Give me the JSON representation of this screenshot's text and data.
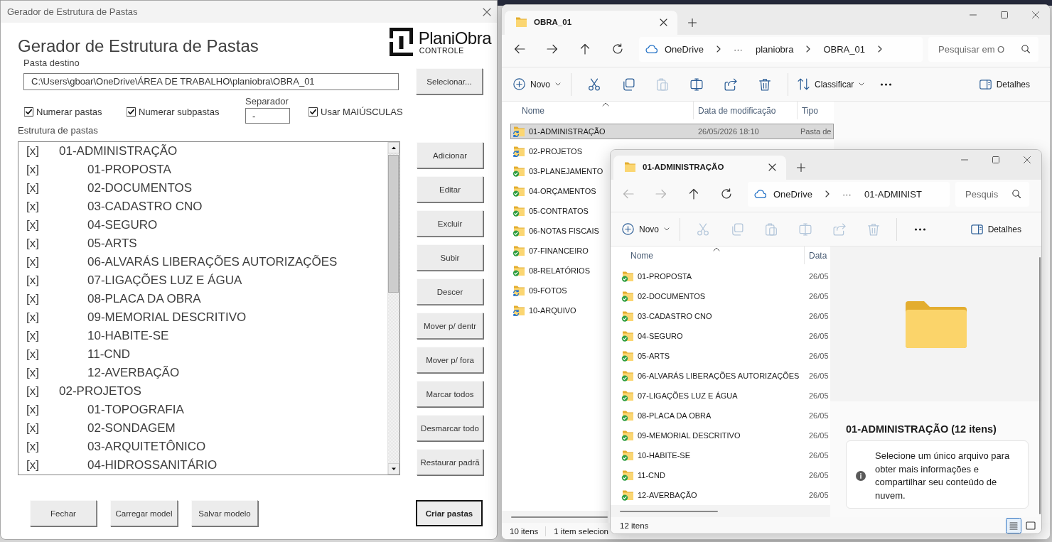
{
  "dialog": {
    "title": "Gerador de Estrutura de Pastas",
    "heading": "Gerador de Estrutura de Pastas",
    "logo": {
      "name": "PlaniObra",
      "tagline": "CONTROLE"
    },
    "destination": {
      "label": "Pasta destino",
      "value": "C:\\Users\\gboar\\OneDrive\\ÁREA DE TRABALHO\\planiobra\\OBRA_01",
      "button": "Selecionar..."
    },
    "options": [
      {
        "kind": "checkbox",
        "label": "Numerar pastas",
        "checked": true
      },
      {
        "kind": "checkbox",
        "label": "Numerar subpastas",
        "checked": true
      },
      {
        "kind": "field",
        "label": "Separador",
        "value": "-"
      },
      {
        "kind": "checkbox",
        "label": "Usar MAIÚSCULAS",
        "checked": true
      }
    ],
    "structure": {
      "label": "Estrutura de pastas",
      "folders": [
        {
          "mark": "[x]",
          "name": "01-ADMINISTRAÇÃO",
          "children": [
            {
              "mark": "[x]",
              "name": "01-PROPOSTA"
            },
            {
              "mark": "[x]",
              "name": "02-DOCUMENTOS"
            },
            {
              "mark": "[x]",
              "name": "03-CADASTRO CNO"
            },
            {
              "mark": "[x]",
              "name": "04-SEGURO"
            },
            {
              "mark": "[x]",
              "name": "05-ARTS"
            },
            {
              "mark": "[x]",
              "name": "06-ALVARÁS LIBERAÇÕES AUTORIZAÇÕES"
            },
            {
              "mark": "[x]",
              "name": "07-LIGAÇÕES LUZ E ÁGUA"
            },
            {
              "mark": "[x]",
              "name": "08-PLACA DA OBRA"
            },
            {
              "mark": "[x]",
              "name": "09-MEMORIAL DESCRITIVO"
            },
            {
              "mark": "[x]",
              "name": "10-HABITE-SE"
            },
            {
              "mark": "[x]",
              "name": "11-CND"
            },
            {
              "mark": "[x]",
              "name": "12-AVERBAÇÃO"
            }
          ]
        },
        {
          "mark": "[x]",
          "name": "02-PROJETOS",
          "children": [
            {
              "mark": "[x]",
              "name": "01-TOPOGRAFIA"
            },
            {
              "mark": "[x]",
              "name": "02-SONDAGEM"
            },
            {
              "mark": "[x]",
              "name": "03-ARQUITETÔNICO"
            },
            {
              "mark": "[x]",
              "name": "04-HIDROSSANITÁRIO"
            }
          ]
        }
      ]
    },
    "side_buttons": [
      "Adicionar",
      "Editar",
      "Excluir",
      "Subir",
      "Descer",
      "Mover p/ dentr",
      "Mover p/ fora",
      "Marcar todos",
      "Desmarcar todo",
      "Restaurar padrã"
    ],
    "footer_buttons": [
      {
        "label": "Fechar",
        "default": false
      },
      {
        "label": "Carregar model",
        "default": false
      },
      {
        "label": "Salvar modelo",
        "default": false
      },
      {
        "label": "Criar pastas",
        "default": true
      }
    ]
  },
  "explorer_windows": [
    {
      "tab": "OBRA_01",
      "nav": [
        {
          "kind": "back",
          "disabled": false
        },
        {
          "kind": "forward",
          "disabled": false
        },
        {
          "kind": "up",
          "disabled": false
        },
        {
          "kind": "refresh",
          "disabled": false
        }
      ],
      "address": [
        {
          "text": "OneDrive",
          "chevron": true
        },
        {
          "text": "···",
          "chevron": false
        },
        {
          "text": "planiobra",
          "chevron": true
        },
        {
          "text": "OBRA_01",
          "chevron": true
        }
      ],
      "search": {
        "placeholder": "Pesquisar em O"
      },
      "toolbar": [
        [
          {
            "kind": "new",
            "label": "Novo",
            "disabled": false
          }
        ],
        [
          {
            "kind": "cut",
            "disabled": false
          },
          {
            "kind": "copy",
            "disabled": false
          },
          {
            "kind": "paste",
            "disabled": true
          },
          {
            "kind": "rename",
            "disabled": false
          },
          {
            "kind": "share",
            "disabled": false
          },
          {
            "kind": "delete",
            "disabled": false
          }
        ],
        [
          {
            "kind": "sort",
            "label": "Classificar",
            "disabled": false
          },
          {
            "kind": "more",
            "disabled": false
          }
        ]
      ],
      "details_button": "Detalhes",
      "columns": [
        "Nome",
        "Data de modificação",
        "Tipo"
      ],
      "rows": [
        {
          "name": "01-ADMINISTRAÇÃO",
          "date": "26/05/2026 18:10",
          "type": "Pasta de",
          "syncing": true,
          "selected": true
        },
        {
          "name": "02-PROJETOS",
          "syncing": true,
          "selected": false
        },
        {
          "name": "03-PLANEJAMENTO",
          "syncing": false,
          "selected": false
        },
        {
          "name": "04-ORÇAMENTOS",
          "syncing": false,
          "selected": false
        },
        {
          "name": "05-CONTRATOS",
          "syncing": false,
          "selected": false
        },
        {
          "name": "06-NOTAS FISCAIS",
          "syncing": false,
          "selected": false
        },
        {
          "name": "07-FINANCEIRO",
          "syncing": false,
          "selected": false
        },
        {
          "name": "08-RELATÓRIOS",
          "syncing": false,
          "selected": false
        },
        {
          "name": "09-FOTOS",
          "syncing": true,
          "selected": false
        },
        {
          "name": "10-ARQUIVO",
          "syncing": true,
          "selected": false
        }
      ],
      "status": [
        "10 itens",
        "1 item selecion"
      ]
    },
    {
      "tab": "01-ADMINISTRAÇÃO",
      "nav": [
        {
          "kind": "back",
          "disabled": true
        },
        {
          "kind": "forward",
          "disabled": true
        },
        {
          "kind": "up",
          "disabled": false
        },
        {
          "kind": "refresh",
          "disabled": false
        }
      ],
      "address": [
        {
          "text": "OneDrive",
          "chevron": true
        },
        {
          "text": "···",
          "chevron": false
        },
        {
          "text": "01-ADMINIST",
          "chevron": false
        }
      ],
      "search": {
        "placeholder": "Pesquis"
      },
      "toolbar": [
        [
          {
            "kind": "new",
            "label": "Novo",
            "disabled": false
          }
        ],
        [
          {
            "kind": "cut",
            "disabled": true
          },
          {
            "kind": "copy",
            "disabled": true
          },
          {
            "kind": "paste",
            "disabled": true
          },
          {
            "kind": "rename",
            "disabled": true
          },
          {
            "kind": "share",
            "disabled": true
          },
          {
            "kind": "delete",
            "disabled": true
          }
        ],
        [
          {
            "kind": "more",
            "disabled": false
          }
        ]
      ],
      "details_button": "Detalhes",
      "columns": [
        "Nome",
        "Data"
      ],
      "rows": [
        {
          "name": "01-PROPOSTA",
          "date": "26/05",
          "syncing": false,
          "selected": false
        },
        {
          "name": "02-DOCUMENTOS",
          "date": "26/05",
          "syncing": false,
          "selected": false
        },
        {
          "name": "03-CADASTRO CNO",
          "date": "26/05",
          "syncing": false,
          "selected": false
        },
        {
          "name": "04-SEGURO",
          "date": "26/05",
          "syncing": false,
          "selected": false
        },
        {
          "name": "05-ARTS",
          "date": "26/05",
          "syncing": false,
          "selected": false
        },
        {
          "name": "06-ALVARÁS LIBERAÇÕES AUTORIZAÇÕES",
          "date": "26/05",
          "syncing": false,
          "selected": false
        },
        {
          "name": "07-LIGAÇÕES LUZ E ÁGUA",
          "date": "26/05",
          "syncing": false,
          "selected": false
        },
        {
          "name": "08-PLACA DA OBRA",
          "date": "26/05",
          "syncing": false,
          "selected": false
        },
        {
          "name": "09-MEMORIAL DESCRITIVO",
          "date": "26/05",
          "syncing": false,
          "selected": false
        },
        {
          "name": "10-HABITE-SE",
          "date": "26/05",
          "syncing": false,
          "selected": false
        },
        {
          "name": "11-CND",
          "date": "26/05",
          "syncing": false,
          "selected": false
        },
        {
          "name": "12-AVERBAÇÃO",
          "date": "26/05",
          "syncing": false,
          "selected": false
        }
      ],
      "details": {
        "title": "01-ADMINISTRAÇÃO (12 itens)",
        "info": "Selecione um único arquivo para obter mais informações e compartilhar seu conteúdo de nuvem."
      },
      "status": [
        "12 itens"
      ],
      "view_buttons": [
        {
          "kind": "details",
          "selected": true
        },
        {
          "kind": "tiles",
          "selected": false
        }
      ]
    }
  ]
}
